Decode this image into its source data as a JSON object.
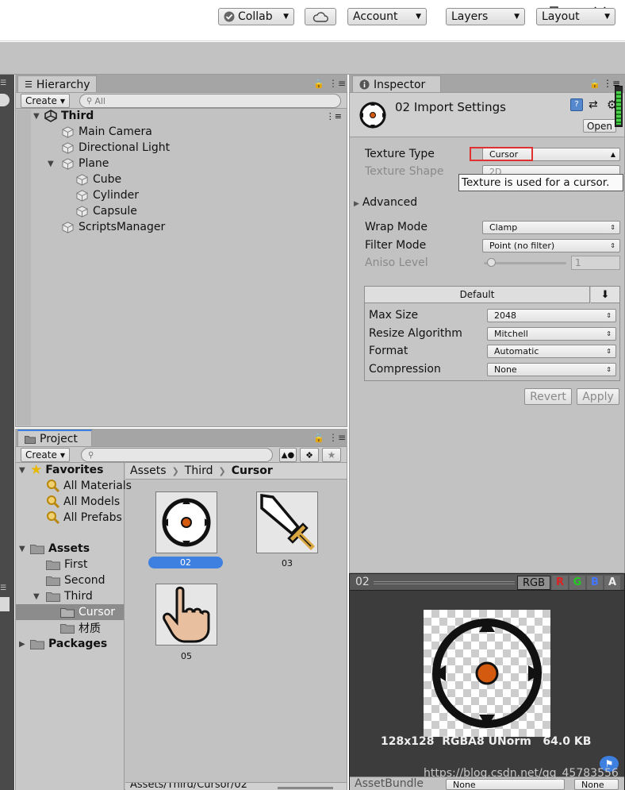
{
  "toolbar": {
    "collab": "Collab",
    "account": "Account",
    "layers": "Layers",
    "layout": "Layout"
  },
  "hierarchy": {
    "tab": "Hierarchy",
    "create": "Create",
    "search_placeholder": "All",
    "scene": "Third",
    "items": [
      "Main Camera",
      "Directional Light",
      "Plane",
      "Cube",
      "Cylinder",
      "Capsule",
      "ScriptsManager"
    ]
  },
  "project": {
    "tab": "Project",
    "create": "Create",
    "favorites": "Favorites",
    "fav_items": [
      "All Materials",
      "All Models",
      "All Prefabs"
    ],
    "assets": "Assets",
    "folders": [
      "First",
      "Second",
      "Third",
      "Cursor",
      "材质"
    ],
    "packages": "Packages",
    "breadcrumb": [
      "Assets",
      "Third",
      "Cursor"
    ],
    "assets_grid": [
      "02",
      "03",
      "05"
    ],
    "footer_path": "Assets/Third/Cursor/02"
  },
  "inspector": {
    "tab": "Inspector",
    "title": "02 Import Settings",
    "open": "Open",
    "texture_type_label": "Texture Type",
    "texture_type_value": "Cursor",
    "texture_shape_label": "Texture Shape",
    "texture_shape_value": "2D",
    "tooltip": "Texture is used for a cursor.",
    "advanced": "Advanced",
    "wrap_mode_label": "Wrap Mode",
    "wrap_mode_value": "Clamp",
    "filter_mode_label": "Filter Mode",
    "filter_mode_value": "Point (no filter)",
    "aniso_label": "Aniso Level",
    "aniso_value": "1",
    "platform_tab": "Default",
    "max_size_label": "Max Size",
    "max_size_value": "2048",
    "resize_label": "Resize Algorithm",
    "resize_value": "Mitchell",
    "format_label": "Format",
    "format_value": "Automatic",
    "compression_label": "Compression",
    "compression_value": "None",
    "revert": "Revert",
    "apply": "Apply"
  },
  "preview": {
    "name": "02",
    "channels": [
      "RGB",
      "R",
      "G",
      "B",
      "A"
    ],
    "info": "128x128  RGBA8 UNorm   64.0 KB",
    "assetbundle_label": "AssetBundle",
    "assetbundle_value": "None",
    "variant_value": "None"
  },
  "watermark": "https://blog.csdn.net/qq_45783556",
  "colors": {
    "panel": "#c2c2c2",
    "selection": "#3d80df",
    "highlight_border": "#e03030",
    "preview_bg": "#3c3c3c",
    "cursor_dot": "#d45a10"
  }
}
